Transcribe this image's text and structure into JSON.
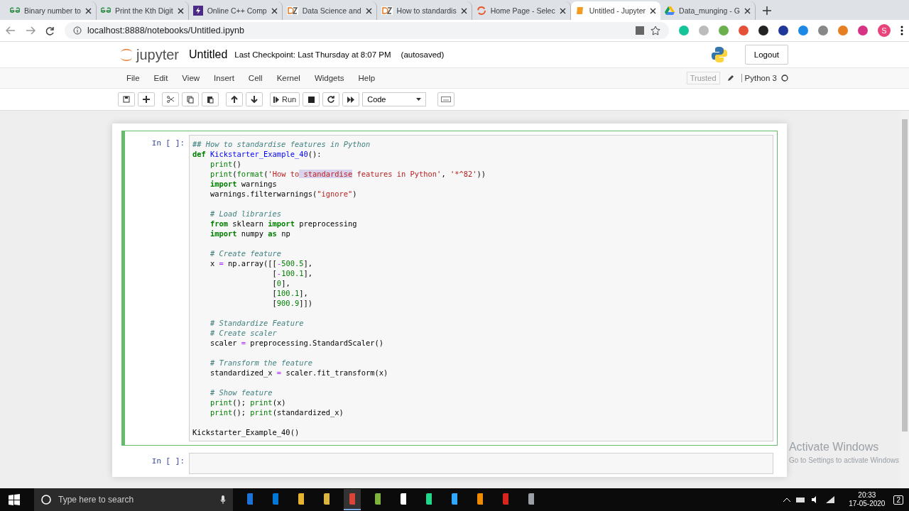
{
  "browser": {
    "tabs": [
      {
        "title": "Binary number to",
        "selected": false
      },
      {
        "title": "Print the Kth Digit",
        "selected": false
      },
      {
        "title": "Online C++ Comp",
        "selected": false
      },
      {
        "title": "Data Science and",
        "selected": false
      },
      {
        "title": "How to standardis",
        "selected": false
      },
      {
        "title": "Home Page - Selec",
        "selected": false
      },
      {
        "title": "Untitled - Jupyter",
        "selected": true
      },
      {
        "title": "Data_munging - G",
        "selected": false
      }
    ],
    "address": "localhost:8888/notebooks/Untitled.ipynb",
    "profile": "S"
  },
  "header": {
    "logo": "jupyter",
    "title": "Untitled",
    "checkpoint": "Last Checkpoint: Last Thursday at 8:07 PM",
    "autosave": "(autosaved)",
    "logout": "Logout"
  },
  "menu": {
    "items": [
      "File",
      "Edit",
      "View",
      "Insert",
      "Cell",
      "Kernel",
      "Widgets",
      "Help"
    ],
    "trusted": "Trusted",
    "kernel": "Python 3"
  },
  "toolbar": {
    "run": "Run",
    "cell_type": "Code"
  },
  "cells": [
    {
      "prompt": "In [ ]:",
      "selected": true,
      "lines": [
        {
          "kind": "code",
          "tokens": [
            {
              "kind": "comment",
              "text": "## How to standardise features in Python"
            }
          ]
        },
        {
          "kind": "code",
          "tokens": [
            {
              "kind": "keyword",
              "text": "def"
            },
            {
              "kind": "function",
              "text": " Kickstarter_Example_40"
            },
            {
              "kind": "plain",
              "text": "():"
            }
          ]
        },
        {
          "kind": "code",
          "tokens": [
            {
              "kind": "builtin",
              "text": "    print"
            },
            {
              "kind": "plain",
              "text": "()"
            }
          ]
        },
        {
          "kind": "code",
          "tokens": [
            {
              "kind": "builtin",
              "text": "    print"
            },
            {
              "kind": "plain",
              "text": "("
            },
            {
              "kind": "builtin",
              "text": "format"
            },
            {
              "kind": "plain",
              "text": "("
            },
            {
              "kind": "string",
              "text": "'How to"
            },
            {
              "kind": "highlight",
              "text": " standardise"
            },
            {
              "kind": "string",
              "text": " features in Python'"
            },
            {
              "kind": "plain",
              "text": ","
            },
            {
              "kind": "string",
              "text": " '*^82'"
            },
            {
              "kind": "plain",
              "text": "))"
            }
          ]
        },
        {
          "kind": "code",
          "tokens": [
            {
              "kind": "keyword",
              "text": "    import"
            },
            {
              "kind": "plain",
              "text": " warnings"
            }
          ]
        },
        {
          "kind": "code",
          "tokens": [
            {
              "kind": "plain",
              "text": "    warnings.filterwarnings("
            },
            {
              "kind": "string",
              "text": "\"ignore\""
            },
            {
              "kind": "plain",
              "text": ")"
            }
          ]
        },
        {
          "kind": "blank"
        },
        {
          "kind": "code",
          "tokens": [
            {
              "kind": "comment",
              "text": "    # Load libraries"
            }
          ]
        },
        {
          "kind": "code",
          "tokens": [
            {
              "kind": "keyword",
              "text": "    from"
            },
            {
              "kind": "plain",
              "text": " sklearn"
            },
            {
              "kind": "keyword",
              "text": " import"
            },
            {
              "kind": "plain",
              "text": " preprocessing"
            }
          ]
        },
        {
          "kind": "code",
          "tokens": [
            {
              "kind": "keyword",
              "text": "    import"
            },
            {
              "kind": "plain",
              "text": " numpy"
            },
            {
              "kind": "keyword",
              "text": " as"
            },
            {
              "kind": "plain",
              "text": " np"
            }
          ]
        },
        {
          "kind": "blank"
        },
        {
          "kind": "code",
          "tokens": [
            {
              "kind": "comment",
              "text": "    # Create feature"
            }
          ]
        },
        {
          "kind": "code",
          "tokens": [
            {
              "kind": "plain",
              "text": "    x"
            },
            {
              "kind": "operator",
              "text": " ="
            },
            {
              "kind": "plain",
              "text": " np.array([["
            },
            {
              "kind": "operator",
              "text": "-"
            },
            {
              "kind": "number",
              "text": "500.5"
            },
            {
              "kind": "plain",
              "text": "],"
            }
          ]
        },
        {
          "kind": "code",
          "tokens": [
            {
              "kind": "plain",
              "text": "                  ["
            },
            {
              "kind": "operator",
              "text": "-"
            },
            {
              "kind": "number",
              "text": "100.1"
            },
            {
              "kind": "plain",
              "text": "],"
            }
          ]
        },
        {
          "kind": "code",
          "tokens": [
            {
              "kind": "plain",
              "text": "                  ["
            },
            {
              "kind": "number",
              "text": "0"
            },
            {
              "kind": "plain",
              "text": "],"
            }
          ]
        },
        {
          "kind": "code",
          "tokens": [
            {
              "kind": "plain",
              "text": "                  ["
            },
            {
              "kind": "number",
              "text": "100.1"
            },
            {
              "kind": "plain",
              "text": "],"
            }
          ]
        },
        {
          "kind": "code",
          "tokens": [
            {
              "kind": "plain",
              "text": "                  ["
            },
            {
              "kind": "number",
              "text": "900.9"
            },
            {
              "kind": "plain",
              "text": "]])"
            }
          ]
        },
        {
          "kind": "blank"
        },
        {
          "kind": "code",
          "tokens": [
            {
              "kind": "comment",
              "text": "    # Standardize Feature"
            }
          ]
        },
        {
          "kind": "code",
          "tokens": [
            {
              "kind": "comment",
              "text": "    # Create scaler"
            }
          ]
        },
        {
          "kind": "code",
          "tokens": [
            {
              "kind": "plain",
              "text": "    scaler"
            },
            {
              "kind": "operator",
              "text": " ="
            },
            {
              "kind": "plain",
              "text": " preprocessing.StandardScaler()"
            }
          ]
        },
        {
          "kind": "blank"
        },
        {
          "kind": "code",
          "tokens": [
            {
              "kind": "comment",
              "text": "    # Transform the feature"
            }
          ]
        },
        {
          "kind": "code",
          "tokens": [
            {
              "kind": "plain",
              "text": "    standardized_x"
            },
            {
              "kind": "operator",
              "text": " ="
            },
            {
              "kind": "plain",
              "text": " scaler.fit_transform(x)"
            }
          ]
        },
        {
          "kind": "blank"
        },
        {
          "kind": "code",
          "tokens": [
            {
              "kind": "comment",
              "text": "    # Show feature"
            }
          ]
        },
        {
          "kind": "code",
          "tokens": [
            {
              "kind": "builtin",
              "text": "    print"
            },
            {
              "kind": "plain",
              "text": "();"
            },
            {
              "kind": "builtin",
              "text": " print"
            },
            {
              "kind": "plain",
              "text": "(x)"
            }
          ]
        },
        {
          "kind": "code",
          "tokens": [
            {
              "kind": "builtin",
              "text": "    print"
            },
            {
              "kind": "plain",
              "text": "();"
            },
            {
              "kind": "builtin",
              "text": " print"
            },
            {
              "kind": "plain",
              "text": "(standardized_x)"
            }
          ]
        },
        {
          "kind": "blank"
        },
        {
          "kind": "code",
          "tokens": [
            {
              "kind": "plain",
              "text": "Kickstarter_Example_40()"
            }
          ]
        }
      ]
    },
    {
      "prompt": "In [ ]:",
      "selected": false
    }
  ],
  "activation": {
    "title": "Activate Windows",
    "hint": "Go to Settings to activate Windows"
  },
  "taskbar": {
    "search": "Type here to search",
    "apps": [
      {
        "color": "#1e73d8",
        "active": false
      },
      {
        "color": "#0078d7",
        "active": false
      },
      {
        "color": "#e8b430",
        "active": false
      },
      {
        "color": "#dcb440",
        "active": false
      },
      {
        "color": "#db4437",
        "active": true
      },
      {
        "color": "#7db33a",
        "active": false
      },
      {
        "color": "#ffffff",
        "active": false
      },
      {
        "color": "#21d789",
        "active": false
      },
      {
        "color": "#31a8ff",
        "active": false
      },
      {
        "color": "#f08a00",
        "active": false
      },
      {
        "color": "#d9251d",
        "active": false
      },
      {
        "color": "#9aa0a6",
        "active": false
      }
    ],
    "time": "20:33",
    "date": "17-05-2020",
    "notifications": "2"
  }
}
